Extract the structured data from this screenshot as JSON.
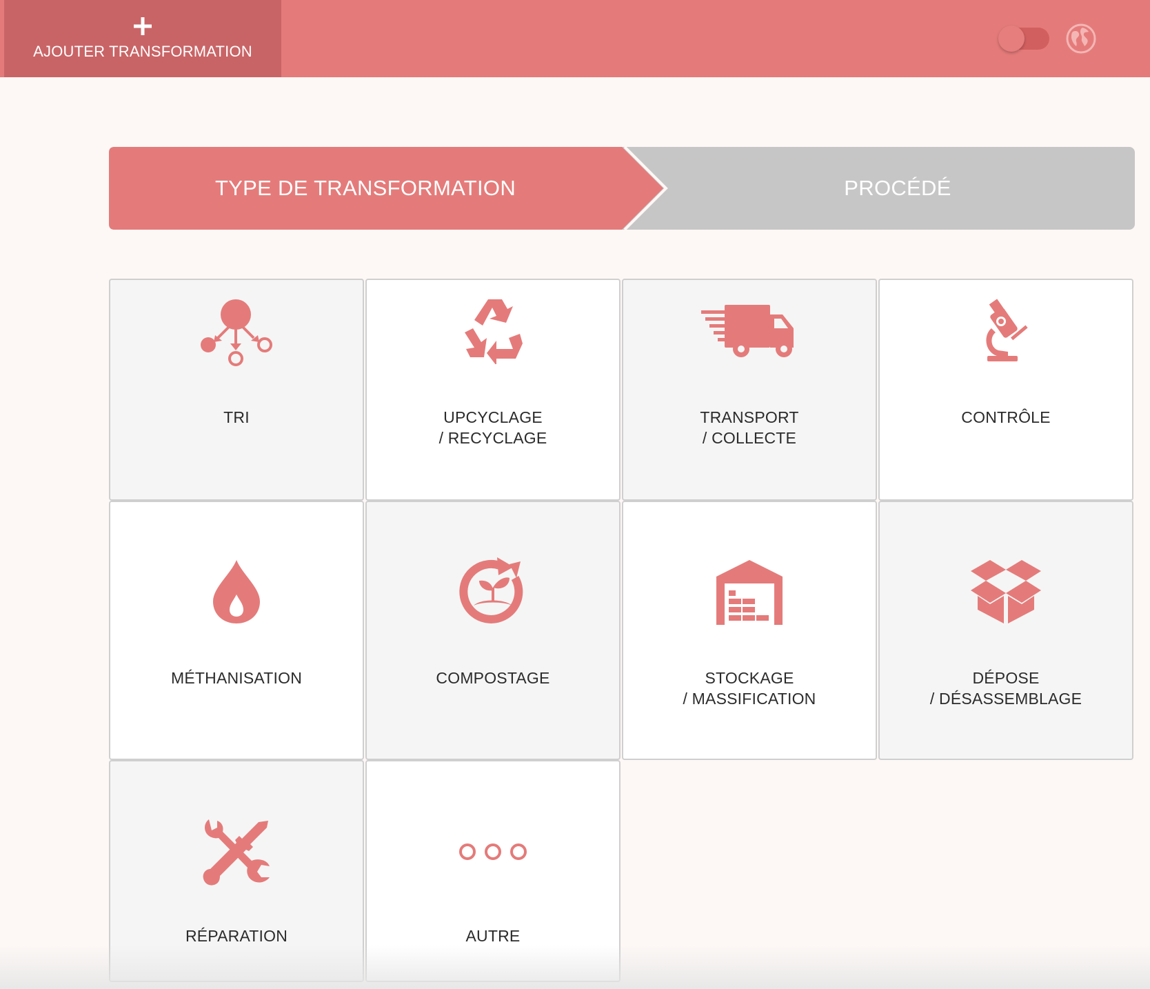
{
  "header": {
    "add_button_label": "AJOUTER TRANSFORMATION",
    "add_icon": "plus-icon",
    "toggle_icon": "toggle-switch",
    "globe_icon": "globe-icon"
  },
  "steps": [
    {
      "label": "TYPE DE TRANSFORMATION",
      "active": true
    },
    {
      "label": "PROCÉDÉ",
      "active": false
    }
  ],
  "colors": {
    "accent": "#e47b7a",
    "accent_dark": "#c96466",
    "inactive_step": "#c6c6c6",
    "background": "#fdf8f6",
    "card_shade": "#f5f5f5",
    "card_border": "#cfcfcf",
    "text": "#2b2b2b"
  },
  "cards": [
    {
      "line1": "TRI",
      "line2": "",
      "icon": "sorting-icon"
    },
    {
      "line1": "UPCYCLAGE",
      "line2": "/ RECYCLAGE",
      "icon": "recycle-icon"
    },
    {
      "line1": "TRANSPORT",
      "line2": "/ COLLECTE",
      "icon": "truck-icon"
    },
    {
      "line1": "CONTRÔLE",
      "line2": "",
      "icon": "microscope-icon"
    },
    {
      "line1": "MÉTHANISATION",
      "line2": "",
      "icon": "flame-drop-icon"
    },
    {
      "line1": "COMPOSTAGE",
      "line2": "",
      "icon": "compost-icon"
    },
    {
      "line1": "STOCKAGE",
      "line2": "/ MASSIFICATION",
      "icon": "warehouse-icon"
    },
    {
      "line1": "DÉPOSE",
      "line2": "/ DÉSASSEMBLAGE",
      "icon": "open-box-icon"
    },
    {
      "line1": "RÉPARATION",
      "line2": "",
      "icon": "tools-icon"
    },
    {
      "line1": "AUTRE",
      "line2": "",
      "icon": "more-dots-icon"
    }
  ]
}
